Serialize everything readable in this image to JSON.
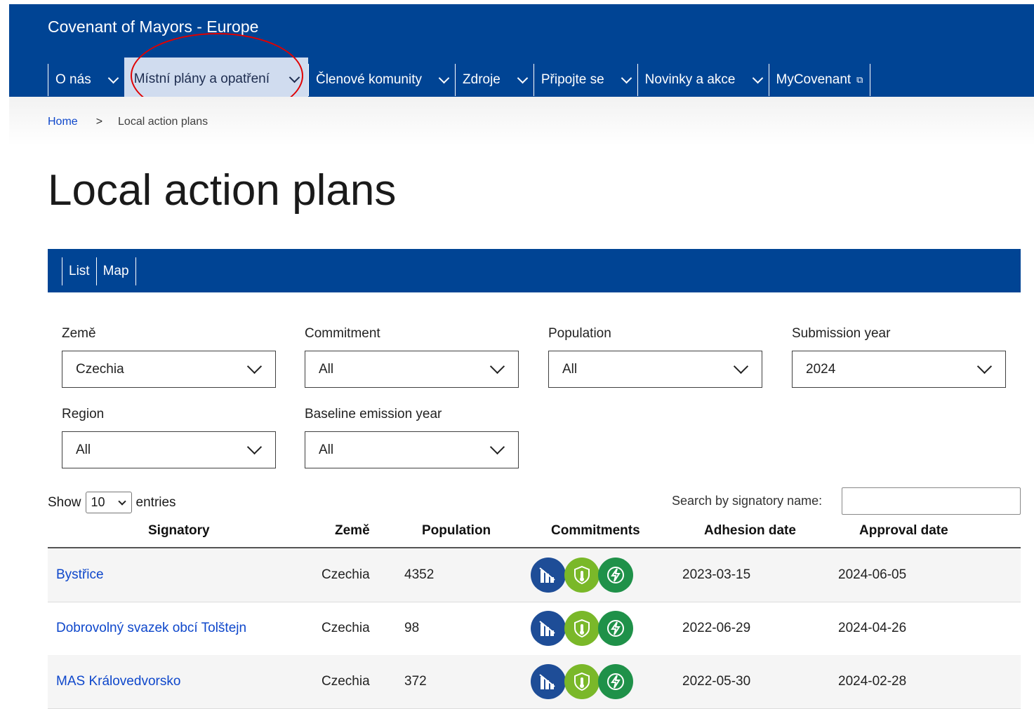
{
  "header": {
    "site_title": "Covenant of Mayors - Europe",
    "nav": [
      {
        "label": "O nás"
      },
      {
        "label": "Místní plány a opatření"
      },
      {
        "label": "Členové komunity"
      },
      {
        "label": "Zdroje"
      },
      {
        "label": "Připojte se"
      },
      {
        "label": "Novinky a akce"
      },
      {
        "label": "MyCovenant"
      }
    ],
    "active_nav": "Místní plány a opatření"
  },
  "breadcrumb": {
    "home": "Home",
    "separator": ">",
    "current": "Local action plans"
  },
  "page_title": "Local action plans",
  "view_tabs": [
    "List",
    "Map"
  ],
  "filters": [
    {
      "label": "Země",
      "value": "Czechia"
    },
    {
      "label": "Commitment",
      "value": "All"
    },
    {
      "label": "Population",
      "value": "All"
    },
    {
      "label": "Submission year",
      "value": "2024"
    },
    {
      "label": "Region",
      "value": "All"
    },
    {
      "label": "Baseline emission year",
      "value": "All"
    }
  ],
  "entries": {
    "show": "Show",
    "value": "10",
    "suffix": "entries"
  },
  "search": {
    "label": "Search by signatory name:",
    "value": ""
  },
  "table": {
    "headers": [
      "Signatory",
      "Země",
      "Population",
      "Commitments",
      "Adhesion date",
      "Approval date"
    ],
    "rows": [
      {
        "signatory": "Bystřice",
        "country": "Czechia",
        "population": "4352",
        "commitments": [
          "mitigation-icon",
          "adaptation-icon",
          "energy-poverty-icon"
        ],
        "adhesion": "2023-03-15",
        "approval": "2024-06-05"
      },
      {
        "signatory": "Dobrovolný svazek obcí Tolštejn",
        "country": "Czechia",
        "population": "98",
        "commitments": [
          "mitigation-icon",
          "adaptation-icon",
          "energy-poverty-icon"
        ],
        "adhesion": "2022-06-29",
        "approval": "2024-04-26"
      },
      {
        "signatory": "MAS Královedvorsko",
        "country": "Czechia",
        "population": "372",
        "commitments": [
          "mitigation-icon",
          "adaptation-icon",
          "energy-poverty-icon"
        ],
        "adhesion": "2022-05-30",
        "approval": "2024-02-28"
      }
    ]
  },
  "colors": {
    "brand_blue": "#004494",
    "active_nav_bg": "#d0dcef",
    "link": "#0e47cb",
    "mitigation": "#1e4d97",
    "adaptation": "#7ab829",
    "energy": "#1f9149",
    "annotation": "#e00000"
  }
}
